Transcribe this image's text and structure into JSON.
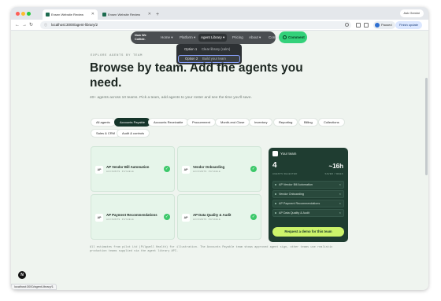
{
  "browser": {
    "tabs": [
      {
        "label": "Ensen Website Review",
        "active": true
      },
      {
        "label": "Ensen Website Review",
        "active": false
      }
    ],
    "new_tab": "+",
    "ask_gemini": "Ask Gemini",
    "url": "localhost:3000/agent-library/2",
    "profile": "Paused",
    "finish_update": "Finish update",
    "status_url": "localhost:3000/agent-library/1"
  },
  "nav": {
    "logo_line1": "Now We",
    "logo_line2": "Collide.",
    "links": {
      "home": "Home",
      "platform": "Platform",
      "agent_library": "Agent Library",
      "pricing": "Pricing",
      "about": "About",
      "contact": "Contact"
    },
    "cta": "Comment"
  },
  "dropdown": {
    "options": [
      {
        "label": "Option 1",
        "desc": "Clear library (calm)"
      },
      {
        "label": "Option 2",
        "desc": "Build your team"
      }
    ]
  },
  "hero": {
    "eyebrow": "EXPLORE AGENTS BY TEAM",
    "headline": "Browse by team. Add the agents you need.",
    "subtext": "40+ agents across 10 teams. Pick a team, add agents to your roster and see the time you'll save."
  },
  "filters": [
    "All agents",
    "Accounts Payable",
    "Accounts Receivable",
    "Procurement",
    "Month-end Close",
    "Inventory",
    "Reporting",
    "Billing",
    "Collections",
    "Sales & CRM",
    "Audit & controls"
  ],
  "active_filter": "Accounts Payable",
  "agents": [
    {
      "badge": "AP",
      "title": "AP Vendor Bill Automation",
      "tag": "ACCOUNTS PAYABLE"
    },
    {
      "badge": "AP",
      "title": "Vendor Onboarding",
      "tag": "ACCOUNTS PAYABLE"
    },
    {
      "badge": "AP",
      "title": "AP Payment Recommendations",
      "tag": "ACCOUNTS PAYABLE"
    },
    {
      "badge": "AP",
      "title": "AP Data Quality & Audit",
      "tag": "ACCOUNTS PAYABLE"
    }
  ],
  "team": {
    "title": "Your team",
    "count": "4",
    "count_label": "AGENTS SELECTED",
    "hours": "~16h",
    "hours_label": "SAVED / WEEK",
    "items": [
      "AP Vendor Bill Automation",
      "Vendor Onboarding",
      "AP Payment Recommendations",
      "AP Data Quality & Audit"
    ],
    "request": "Request a demo for this team"
  },
  "footnote": "All estimates from pilot Ltd (Pilgwell Health) for illustration. The Accounts Payable team shows approved agent sign, other teams use realistic production teams supplied via the agent library API.",
  "fab_label": "N"
}
